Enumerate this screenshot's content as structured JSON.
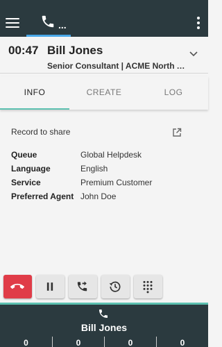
{
  "header": {
    "tab_more": "..."
  },
  "call": {
    "timer": "00:47",
    "caller_name": "Bill Jones",
    "caller_subtitle": "Senior Consultant | ACME North America"
  },
  "tabs": [
    {
      "label": "INFO",
      "active": true
    },
    {
      "label": "CREATE",
      "active": false
    },
    {
      "label": "LOG",
      "active": false
    }
  ],
  "info": {
    "record_label": "Record to share",
    "fields": [
      {
        "key": "Queue",
        "value": "Global Helpdesk"
      },
      {
        "key": "Language",
        "value": "English"
      },
      {
        "key": "Service",
        "value": "Premium Customer"
      },
      {
        "key": "Preferred Agent",
        "value": "John Doe"
      }
    ]
  },
  "controls": [
    {
      "icon": "hang-up-icon",
      "color": "#e03c48"
    },
    {
      "icon": "pause-icon"
    },
    {
      "icon": "transfer-call-icon"
    },
    {
      "icon": "history-icon"
    },
    {
      "icon": "dialpad-icon"
    }
  ],
  "footer": {
    "name": "Bill Jones",
    "counters": [
      "0",
      "0",
      "0",
      "0"
    ]
  },
  "colors": {
    "topbar": "#2b3a3f",
    "accent_blue": "#4aa8e8",
    "accent_teal": "#5cc0b0",
    "hangup_red": "#e03c48"
  }
}
